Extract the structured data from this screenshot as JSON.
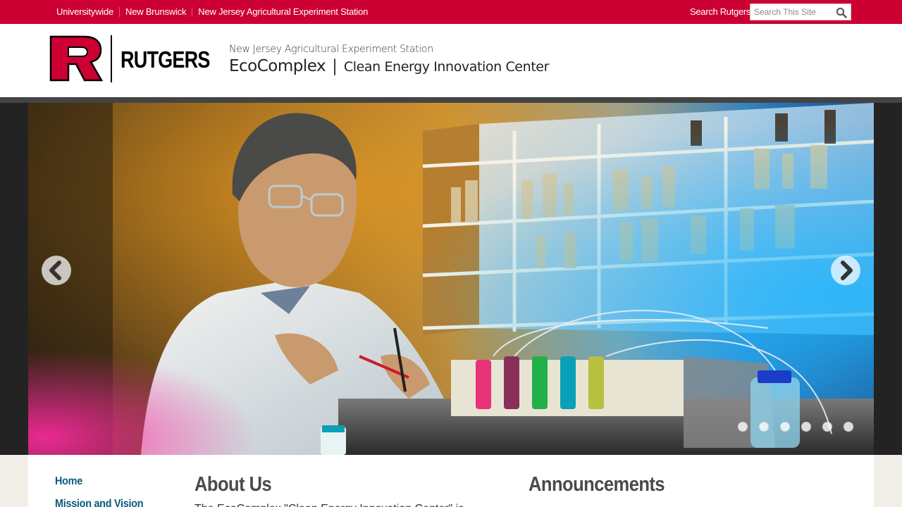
{
  "topbar": {
    "links": [
      "Universitywide",
      "New Brunswick",
      "New Jersey Agricultural Experiment Station"
    ],
    "search_label": "Search Rutgers",
    "search_placeholder": "Search This Site"
  },
  "header": {
    "logo_text": "RUTGERS",
    "unit_name": "New Jersey Agricultural Experiment Station",
    "site_name": "EcoComplex",
    "separator": "|",
    "site_subtitle": "Clean Energy Innovation Center"
  },
  "slider": {
    "slide_count": 6,
    "active_index": 0
  },
  "sidebar": {
    "items": [
      {
        "label": "Home"
      },
      {
        "label": "Mission and Vision"
      }
    ]
  },
  "main": {
    "about_title": "About Us",
    "about_text": "The EcoComplex \"Clean Energy Innovation Center\" is",
    "announcements_title": "Announcements"
  },
  "colors": {
    "brand_red": "#cc0033",
    "nav_link": "#0a5a7f",
    "heading": "#4a4a4a"
  }
}
